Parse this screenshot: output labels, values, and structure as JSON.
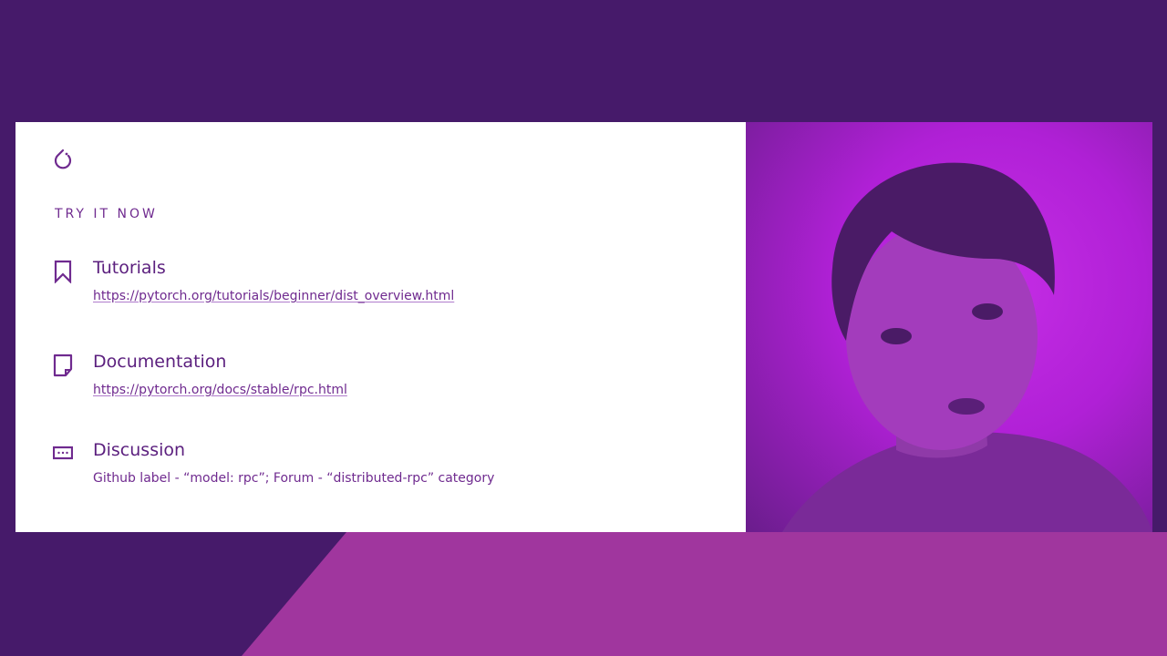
{
  "slide": {
    "kicker": "TRY IT NOW",
    "resources": [
      {
        "icon": "bookmark-icon",
        "title": "Tutorials",
        "link": "https://pytorch.org/tutorials/beginner/dist_overview.html"
      },
      {
        "icon": "document-icon",
        "title": "Documentation",
        "link": "https://pytorch.org/docs/stable/rpc.html"
      },
      {
        "icon": "chat-icon",
        "title": "Discussion",
        "text": "Github label - “model: rpc”;  Forum - “distributed-rpc” category"
      }
    ]
  },
  "colors": {
    "page_background": "#461a6a",
    "accent": "#6f2a8f",
    "wedge": "#a0369e",
    "video_background": "#c62ee6"
  }
}
